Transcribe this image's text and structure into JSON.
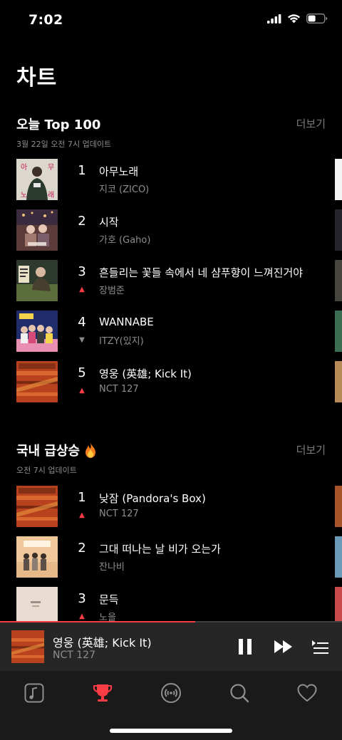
{
  "status": {
    "time": "7:02"
  },
  "page": {
    "title": "차트"
  },
  "top100": {
    "title": "오늘 Top 100",
    "subtitle": "3월 22일 오전 7시 업데이트",
    "more_label": "더보기",
    "items": [
      {
        "rank": "1",
        "title": "아무노래",
        "artist": "지코 (ZICO)",
        "trend": "none"
      },
      {
        "rank": "2",
        "title": "시작",
        "artist": "가호 (Gaho)",
        "trend": "none"
      },
      {
        "rank": "3",
        "title": "흔들리는 꽃들 속에서 네 샴푸향이 느껴진거야",
        "artist": "장범준",
        "trend": "up"
      },
      {
        "rank": "4",
        "title": "WANNABE",
        "artist": "ITZY(있지)",
        "trend": "down"
      },
      {
        "rank": "5",
        "title": "영웅 (英雄; Kick It)",
        "artist": "NCT 127",
        "trend": "up"
      }
    ]
  },
  "rising": {
    "title": "국내 급상승",
    "icon": "fire-icon",
    "subtitle": "오전 7시 업데이트",
    "more_label": "더보기",
    "items": [
      {
        "rank": "1",
        "title": "낮잠 (Pandora's Box)",
        "artist": "NCT 127",
        "trend": "up"
      },
      {
        "rank": "2",
        "title": "그대 떠나는 날 비가 오는가",
        "artist": "잔나비",
        "trend": "none"
      },
      {
        "rank": "3",
        "title": "문득",
        "artist": "노을",
        "trend": "up"
      }
    ]
  },
  "now_playing": {
    "title": "영웅 (英雄; Kick It)",
    "artist": "NCT 127",
    "progress": 0.57
  },
  "tabs": [
    {
      "name": "tab-library",
      "icon": "music-note-icon",
      "active": false
    },
    {
      "name": "tab-charts",
      "icon": "trophy-icon",
      "active": true
    },
    {
      "name": "tab-radio",
      "icon": "radio-icon",
      "active": false
    },
    {
      "name": "tab-search",
      "icon": "search-icon",
      "active": false
    },
    {
      "name": "tab-favorites",
      "icon": "heart-icon",
      "active": false
    }
  ],
  "colors": {
    "accent": "#fc3c44",
    "secondary_text": "#8e8e8e",
    "background": "#000000"
  }
}
